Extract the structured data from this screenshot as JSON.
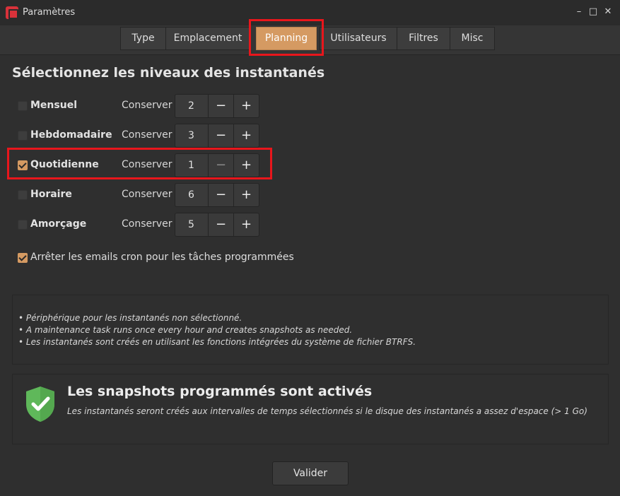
{
  "window": {
    "title": "Paramètres"
  },
  "tabs": [
    {
      "label": "Type"
    },
    {
      "label": "Emplacement"
    },
    {
      "label": "Planning",
      "active": true
    },
    {
      "label": "Utilisateurs"
    },
    {
      "label": "Filtres"
    },
    {
      "label": "Misc"
    }
  ],
  "section_title": "Sélectionnez les niveaux des instantanés",
  "levels": [
    {
      "label": "Mensuel",
      "keep_label": "Conserver",
      "value": "2",
      "checked": false
    },
    {
      "label": "Hebdomadaire",
      "keep_label": "Conserver",
      "value": "3",
      "checked": false
    },
    {
      "label": "Quotidienne",
      "keep_label": "Conserver",
      "value": "1",
      "checked": true
    },
    {
      "label": "Horaire",
      "keep_label": "Conserver",
      "value": "6",
      "checked": false
    },
    {
      "label": "Amorçage",
      "keep_label": "Conserver",
      "value": "5",
      "checked": false
    }
  ],
  "spin": {
    "minus": "−",
    "plus": "+"
  },
  "cron": {
    "label": "Arrêter les emails cron pour les tâches programmées",
    "checked": true
  },
  "info": [
    "• Périphérique pour les instantanés non sélectionné.",
    "• A maintenance task runs once every hour and creates snapshots as needed.",
    "• Les instantanés sont créés en utilisant les fonctions intégrées du système de fichier BTRFS."
  ],
  "status": {
    "title": "Les snapshots programmés sont activés",
    "description": "Les instantanés seront créés aux intervalles de temps sélectionnés si le disque des instantanés a assez d'espace (> 1 Go)"
  },
  "ok_button": "Valider",
  "colors": {
    "accent": "#d59a62",
    "highlight": "#e8161c",
    "shield": "#5fb85a"
  },
  "icons": {
    "app": "timeshift-icon",
    "shield": "shield-check-icon"
  }
}
